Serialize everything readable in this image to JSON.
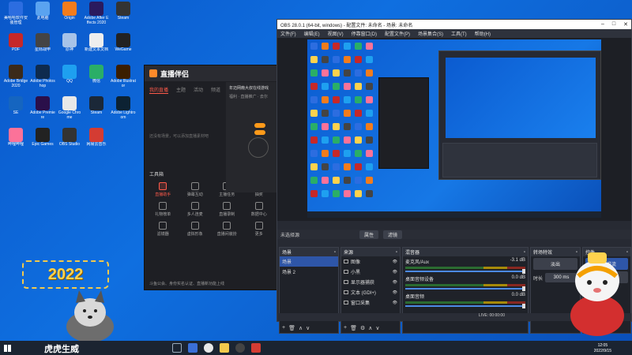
{
  "desktop": {
    "icons": [
      {
        "label": "美哈哈软件安装管理",
        "color": "#2c6de0"
      },
      {
        "label": "此电脑",
        "color": "#5aa3f0"
      },
      {
        "label": "Origin",
        "color": "#f27c1c"
      },
      {
        "label": "Adobe After Effects 2020",
        "color": "#2a1a5e"
      },
      {
        "label": "Steam",
        "color": "#333"
      },
      {
        "label": "PDF",
        "color": "#c62828"
      },
      {
        "label": "星际战甲",
        "color": "#444"
      },
      {
        "label": "原神",
        "color": "#a7c3e8"
      },
      {
        "label": "新建文本文档",
        "color": "#eee"
      },
      {
        "label": "WeGame",
        "color": "#222"
      },
      {
        "label": "Adobe Bridge 2020",
        "color": "#3b2a1a"
      },
      {
        "label": "Adobe Photoshop",
        "color": "#0e2b4f"
      },
      {
        "label": "QQ",
        "color": "#1ea0f0"
      },
      {
        "label": "微信",
        "color": "#2aae67"
      },
      {
        "label": "Adobe Illustrator",
        "color": "#3b1e00"
      },
      {
        "label": "SE",
        "color": "#1565c0"
      },
      {
        "label": "Adobe Premiere",
        "color": "#2a0f4a"
      },
      {
        "label": "Google Chrome",
        "color": "#e8e8e8"
      },
      {
        "label": "Steam",
        "color": "#1b2838"
      },
      {
        "label": "Adobe Lightroom",
        "color": "#0c2233"
      },
      {
        "label": "哔哩哔哩",
        "color": "#fb7299"
      },
      {
        "label": "Epic Games",
        "color": "#222"
      },
      {
        "label": "OBS Studio",
        "color": "#333"
      },
      {
        "label": "网易云音乐",
        "color": "#d43c33"
      }
    ]
  },
  "companion": {
    "title": "直播伴侣",
    "tabs": [
      "我的直播",
      "主题",
      "活动",
      "频道"
    ],
    "empty_text": "还没有场景，可以添加直播素材吧",
    "tools_title": "工具箱",
    "tools": [
      {
        "label": "直播助手",
        "hot": true
      },
      {
        "label": "弹幕互动",
        "hot": false
      },
      {
        "label": "主播任务",
        "hot": false
      },
      {
        "label": "抽奖",
        "hot": false
      },
      {
        "label": "礼物榜单",
        "hot": false
      },
      {
        "label": "多人连麦",
        "hot": false
      },
      {
        "label": "直播录制",
        "hot": false
      },
      {
        "label": "数据中心",
        "hot": false
      },
      {
        "label": "滤镜器",
        "hot": false
      },
      {
        "label": "虚拟形象",
        "hot": false
      },
      {
        "label": "直播间装扮",
        "hot": false
      },
      {
        "label": "更多",
        "hot": false
      }
    ],
    "footer": "斗鱼公会、身份实名认证、直播新功能上线",
    "side_notice": "年迈网瘾大叔在线游戏",
    "side_sub": "福利 · 直播推广 · 去尔"
  },
  "obs": {
    "title": "OBS 28.0.1 (64-bit, windows) - 配置文件: 未命名 - 场景: 未命名",
    "window_controls": [
      "–",
      "□",
      "✕"
    ],
    "menu": [
      "文件(F)",
      "编辑(E)",
      "视图(V)",
      "停靠窗口(D)",
      "配置文件(P)",
      "场景集合(S)",
      "工具(T)",
      "帮助(H)"
    ],
    "no_source": "未选择源",
    "props_btn": "属性",
    "filters_btn": "滤镜",
    "docks": {
      "scenes": {
        "title": "场景",
        "items": [
          "场景",
          "场景 2"
        ],
        "selected": 0
      },
      "sources": {
        "title": "来源",
        "items": [
          "图像",
          "小黑",
          "显示器捕获",
          "文本 (GDI+)",
          "窗口采集"
        ]
      },
      "mixer": {
        "title": "混音器",
        "channels": [
          {
            "name": "麦克风/Aux",
            "db": "-3.1 dB"
          },
          {
            "name": "桌面音频设备",
            "db": "0.0 dB"
          },
          {
            "name": "桌面音频",
            "db": "0.0 dB"
          }
        ]
      },
      "transitions": {
        "title": "转场特效",
        "type": "淡出",
        "duration_label": "时长",
        "duration": "300 ms"
      },
      "controls": {
        "title": "控件",
        "buttons": [
          "停止推流",
          "开始录制",
          "启动虚拟摄像机",
          "工作室模式",
          "设置",
          "退出"
        ]
      }
    },
    "status": "LIVE: 00:00:00"
  },
  "taskbar": {
    "clock_time": "12:05",
    "clock_date": "2022/9/15"
  },
  "overlay": {
    "year_text": "2022",
    "calligraphy": "虎虎生威"
  }
}
